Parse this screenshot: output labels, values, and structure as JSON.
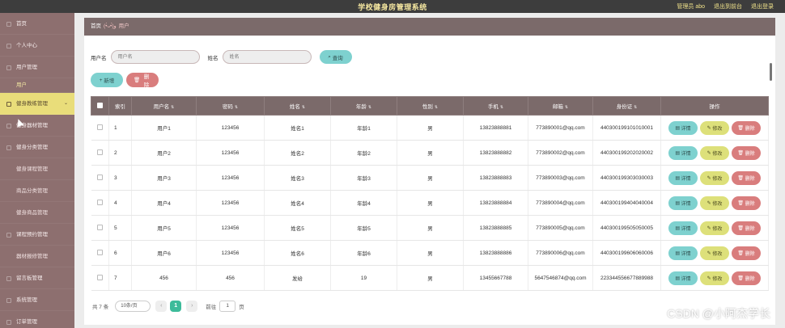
{
  "topbar": {
    "title": "学校健身房管理系统",
    "admin_label": "管理员 abo",
    "back_front": "退出到前台",
    "logout": "退出登录"
  },
  "sidebar": {
    "items": [
      {
        "label": "首页"
      },
      {
        "label": "个人中心"
      },
      {
        "label": "用户管理"
      },
      {
        "label": "用户"
      },
      {
        "label": "健身教练管理"
      },
      {
        "label": "健身器材管理"
      },
      {
        "label": "健身分类管理"
      },
      {
        "label": "健身课程管理"
      },
      {
        "label": "商品分类管理"
      },
      {
        "label": "健身商品管理"
      },
      {
        "label": "课程预约管理"
      },
      {
        "label": "器材报修管理"
      },
      {
        "label": "留言板管理"
      },
      {
        "label": "系统管理"
      },
      {
        "label": "订单管理"
      }
    ]
  },
  "breadcrumb": {
    "home": "首页",
    "sep": "(•̀ᴗ•́)و",
    "current": "用户"
  },
  "search": {
    "username_label": "用户名",
    "username_placeholder": "用户名",
    "name_label": "姓名",
    "name_placeholder": "姓名",
    "query_label": "查询"
  },
  "actions": {
    "add_label": "新增",
    "delete_label": "删除"
  },
  "table": {
    "headers": {
      "index": "索引",
      "username": "用户名",
      "password": "密码",
      "name": "姓名",
      "age": "年龄",
      "gender": "性别",
      "phone": "手机",
      "email": "邮箱",
      "idcard": "身份证",
      "ops": "操作"
    },
    "op_labels": {
      "detail": "详情",
      "edit": "修改",
      "delete": "删除"
    },
    "rows": [
      {
        "index": "1",
        "username": "用户1",
        "password": "123456",
        "name": "姓名1",
        "age": "年龄1",
        "gender": "男",
        "phone": "13823888881",
        "email": "773890001@qq.com",
        "idcard": "440300199101010001"
      },
      {
        "index": "2",
        "username": "用户2",
        "password": "123456",
        "name": "姓名2",
        "age": "年龄2",
        "gender": "男",
        "phone": "13823888882",
        "email": "773890002@qq.com",
        "idcard": "440300199202020002"
      },
      {
        "index": "3",
        "username": "用户3",
        "password": "123456",
        "name": "姓名3",
        "age": "年龄3",
        "gender": "男",
        "phone": "13823888883",
        "email": "773890003@qq.com",
        "idcard": "440300199303030003"
      },
      {
        "index": "4",
        "username": "用户4",
        "password": "123456",
        "name": "姓名4",
        "age": "年龄4",
        "gender": "男",
        "phone": "13823888884",
        "email": "773890004@qq.com",
        "idcard": "440300199404040004"
      },
      {
        "index": "5",
        "username": "用户5",
        "password": "123456",
        "name": "姓名5",
        "age": "年龄5",
        "gender": "男",
        "phone": "13823888885",
        "email": "773890005@qq.com",
        "idcard": "440300199505050005"
      },
      {
        "index": "6",
        "username": "用户6",
        "password": "123456",
        "name": "姓名6",
        "age": "年龄6",
        "gender": "男",
        "phone": "13823888886",
        "email": "773890006@qq.com",
        "idcard": "440300199606060006"
      },
      {
        "index": "7",
        "username": "456",
        "password": "456",
        "name": "发给",
        "age": "19",
        "gender": "男",
        "phone": "13455667788",
        "email": "5647546874@qq.com",
        "idcard": "223344556677889988"
      }
    ]
  },
  "pager": {
    "total": "共 7 条",
    "per_page": "10条/页",
    "prev": "‹",
    "current": "1",
    "next": "›",
    "goto": "前往",
    "jump_value": "1",
    "unit": "页"
  },
  "watermark": "CSDN @小阿杰学长",
  "colors": {
    "sidebar": "#8d6f6f",
    "active": "#e9dd7a",
    "header": "#7b6a6a",
    "teal": "#7ed1cf",
    "red": "#d97d7d",
    "yellow": "#dde07a"
  }
}
